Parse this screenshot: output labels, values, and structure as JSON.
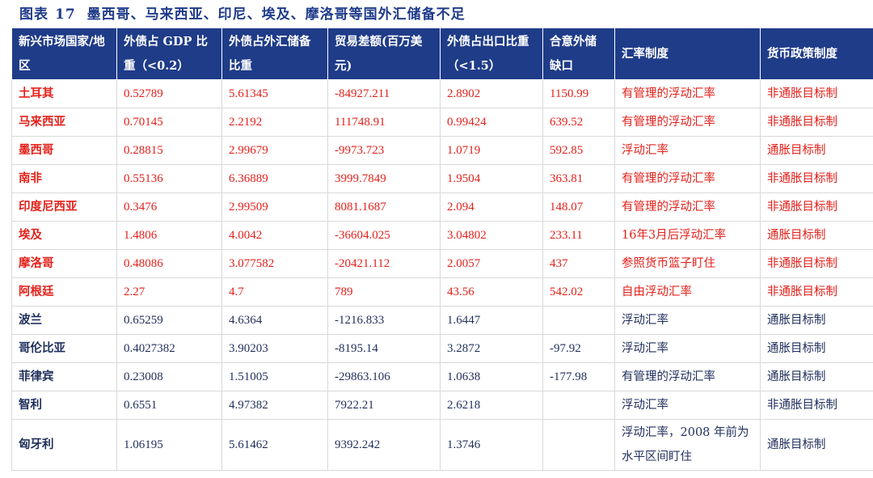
{
  "title": {
    "label": "图表",
    "number": "17",
    "text": "墨西哥、马来西亚、印尼、埃及、摩洛哥等国外汇储备不足"
  },
  "colors": {
    "header_bg": "#1f3c88",
    "highlight": "#e3211b",
    "normal_text": "#1f2f5c"
  },
  "headers": [
    "新兴市场国家/地区",
    "外债占 GDP 比重（<0.2）",
    "外债占外汇储备比重",
    "贸易差额(百万美元)",
    "外债占出口比重（<1.5）",
    "合意外储缺口",
    "汇率制度",
    "货币政策制度"
  ],
  "rows": [
    {
      "highlight": true,
      "cells": [
        "土耳其",
        "0.52789",
        "5.61345",
        "-84927.211",
        "2.8902",
        "1150.99",
        "有管理的浮动汇率",
        "非通胀目标制"
      ]
    },
    {
      "highlight": true,
      "cells": [
        "马来西亚",
        "0.70145",
        "2.2192",
        "111748.91",
        "0.99424",
        "639.52",
        "有管理的浮动汇率",
        "非通胀目标制"
      ]
    },
    {
      "highlight": true,
      "cells": [
        "墨西哥",
        "0.28815",
        "2.99679",
        "-9973.723",
        "1.0719",
        "592.85",
        "浮动汇率",
        "通胀目标制"
      ]
    },
    {
      "highlight": true,
      "cells": [
        "南非",
        "0.55136",
        "6.36889",
        "3999.7849",
        "1.9504",
        "363.81",
        "有管理的浮动汇率",
        "非通胀目标制"
      ]
    },
    {
      "highlight": true,
      "cells": [
        "印度尼西亚",
        "0.3476",
        "2.99509",
        "8081.1687",
        "2.094",
        "148.07",
        "有管理的浮动汇率",
        "非通胀目标制"
      ]
    },
    {
      "highlight": true,
      "cells": [
        "埃及",
        "1.4806",
        "4.0042",
        "-36604.025",
        "3.04802",
        "233.11",
        "16年3月后浮动汇率",
        "通胀目标制"
      ]
    },
    {
      "highlight": true,
      "cells": [
        "摩洛哥",
        "0.48086",
        "3.077582",
        "-20421.112",
        "2.0057",
        "437",
        "参照货币篮子盯住",
        "非通胀目标制"
      ]
    },
    {
      "highlight": true,
      "cells": [
        "阿根廷",
        "2.27",
        "4.7",
        "789",
        "43.56",
        "542.02",
        "自由浮动汇率",
        "非通胀目标制"
      ]
    },
    {
      "highlight": false,
      "cells": [
        "波兰",
        "0.65259",
        "4.6364",
        "-1216.833",
        "1.6447",
        "",
        "浮动汇率",
        "通胀目标制"
      ]
    },
    {
      "highlight": false,
      "cells": [
        "哥伦比亚",
        "0.4027382",
        "3.90203",
        "-8195.14",
        "3.2872",
        "-97.92",
        "浮动汇率",
        "通胀目标制"
      ]
    },
    {
      "highlight": false,
      "cells": [
        "菲律宾",
        "0.23008",
        "1.51005",
        "-29863.106",
        "1.0638",
        "-177.98",
        "有管理的浮动汇率",
        "通胀目标制"
      ]
    },
    {
      "highlight": false,
      "cells": [
        "智利",
        "0.6551",
        "4.97382",
        "7922.21",
        "2.6218",
        "",
        "浮动汇率",
        "非通胀目标制"
      ]
    },
    {
      "highlight": false,
      "tall": true,
      "cells": [
        "匈牙利",
        "1.06195",
        "5.61462",
        "9392.242",
        "1.3746",
        "",
        "浮动汇率，2008 年前为水平区间盯住",
        "通胀目标制"
      ]
    }
  ]
}
